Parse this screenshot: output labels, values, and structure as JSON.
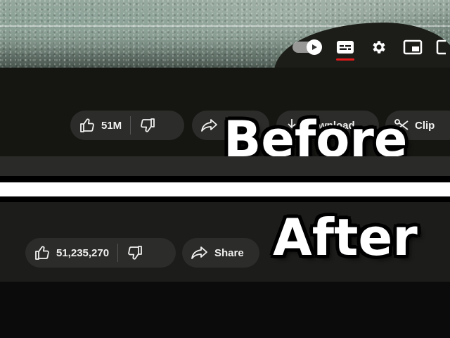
{
  "video": {
    "controls": [
      {
        "name": "autoplay-toggle",
        "icon": "play-icon"
      },
      {
        "name": "subtitles-button",
        "icon": "subtitles-icon",
        "active": true
      },
      {
        "name": "settings-button",
        "icon": "gear-icon"
      },
      {
        "name": "miniplayer-button",
        "icon": "miniplayer-icon"
      },
      {
        "name": "theater-button",
        "icon": "theater-icon"
      }
    ],
    "active_underline_color": "#e31b1b"
  },
  "before": {
    "label": "Before",
    "likes": "51M",
    "share_label": "Share",
    "download_label": "Download",
    "clip_label": "Clip"
  },
  "after": {
    "label": "After",
    "likes": "51,235,270",
    "share_label": "Share"
  },
  "colors": {
    "pill_background": "#2c2c2a",
    "text": "#f1f1f1",
    "divider_white": "#ffffff"
  }
}
